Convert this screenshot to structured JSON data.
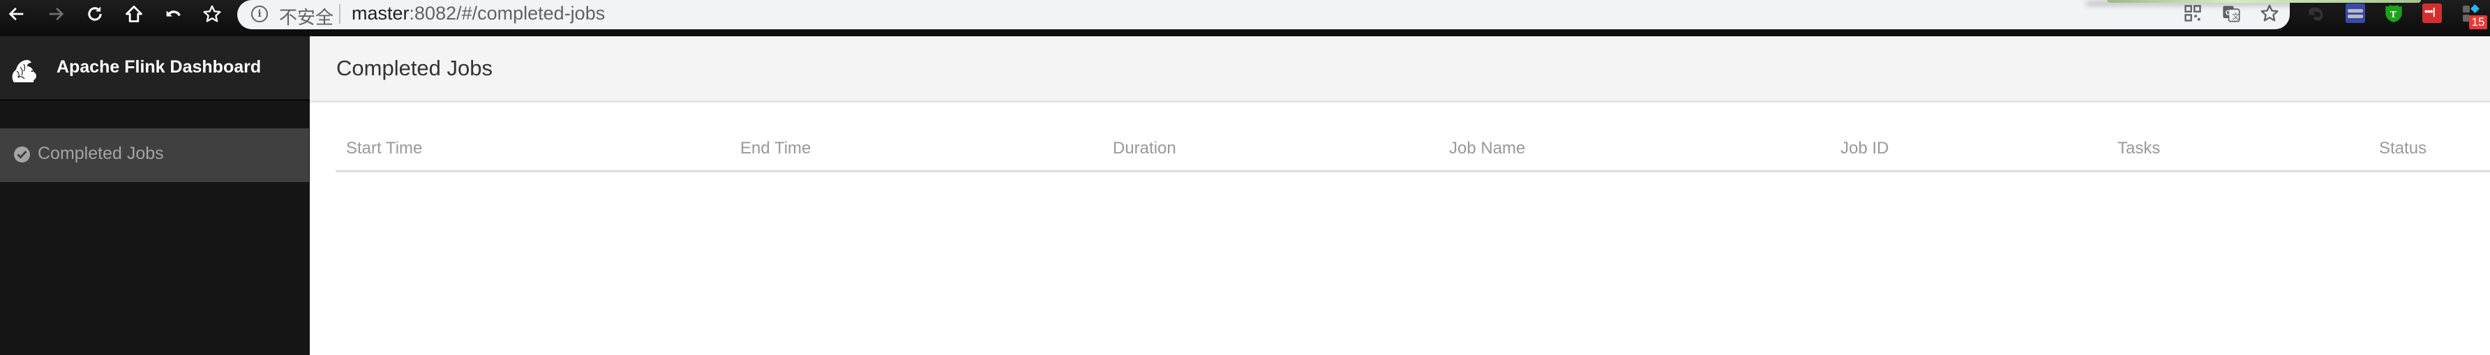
{
  "browser": {
    "security_label": "不安全",
    "url_host": "master",
    "url_rest": ":8082/#/completed-jobs",
    "nav_icons": [
      "back-arrow-icon",
      "forward-arrow-icon",
      "reload-icon",
      "home-icon",
      "undo-icon",
      "bookmark-star-icon"
    ],
    "address_icons": [
      "qr-code-icon",
      "translate-icon",
      "bookmark-star-icon"
    ],
    "extension_icons": [
      "extension-arrow-icon",
      "extension-reader-icon",
      "extension-t-shield-icon",
      "extension-lastpass-icon",
      "extension-apps-icon"
    ],
    "extension_badge": "15",
    "colors": {
      "shield": "#1aa31a",
      "lastpass": "#d32f2f",
      "reader": "#3949ab",
      "badge": "#e53935"
    }
  },
  "sidebar": {
    "brand": "Apache Flink Dashboard",
    "items": [
      {
        "label": "Completed Jobs",
        "icon": "check-circle-icon",
        "active": true
      }
    ]
  },
  "main": {
    "title": "Completed Jobs",
    "table": {
      "columns": [
        "Start Time",
        "End Time",
        "Duration",
        "Job Name",
        "Job ID",
        "Tasks",
        "Status"
      ],
      "rows": []
    }
  }
}
